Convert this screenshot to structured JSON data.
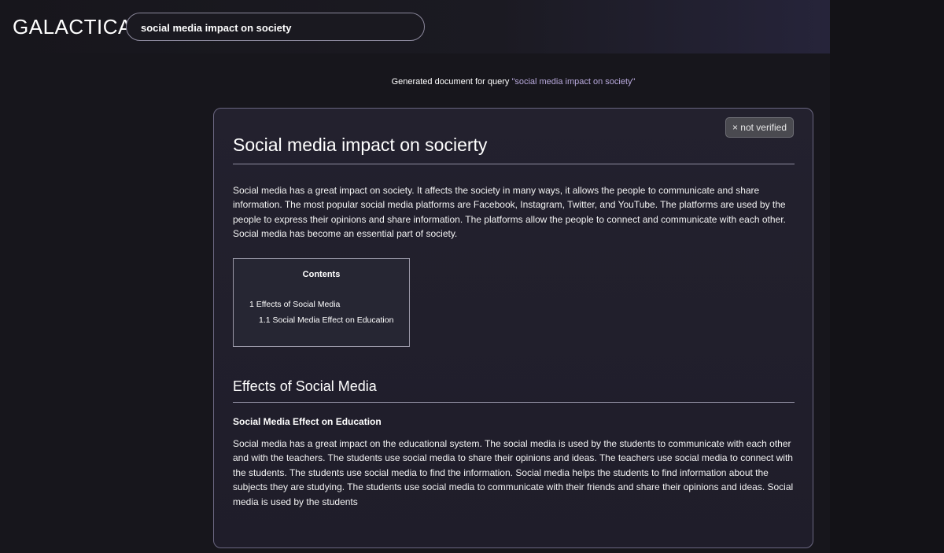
{
  "app": {
    "logo": "GALACTICA"
  },
  "search": {
    "value": "social media impact on society"
  },
  "query_line": {
    "prefix": "Generated document for query ",
    "query": "\"social media impact on society\""
  },
  "document": {
    "badge": "× not verified",
    "title": "Social media impact on socierty",
    "intro": "Social media has a great impact on society. It affects the society in many ways, it allows the people to communicate and share information. The most popular social media platforms are Facebook, Instagram, Twitter, and YouTube. The platforms are used by the people to express their opinions and share information. The platforms allow the people to connect and communicate with each other. Social media has become an essential part of society.",
    "contents": {
      "title": "Contents",
      "items": [
        "1 Effects of Social Media",
        "1.1 Social Media Effect on Education"
      ]
    },
    "section_title": "Effects of Social Media",
    "subsection_title": "Social Media Effect on Education",
    "subsection_text": "Social media has a great impact on the educational system. The social media is used by the students to communicate with each other and with the teachers. The students use social media to share their opinions and ideas. The teachers use social media to connect with the students. The students use social media to find the information. Social media helps the students to find information about the subjects they are studying. The students use social media to communicate with their friends and share their opinions and ideas. Social media is used by the students"
  }
}
